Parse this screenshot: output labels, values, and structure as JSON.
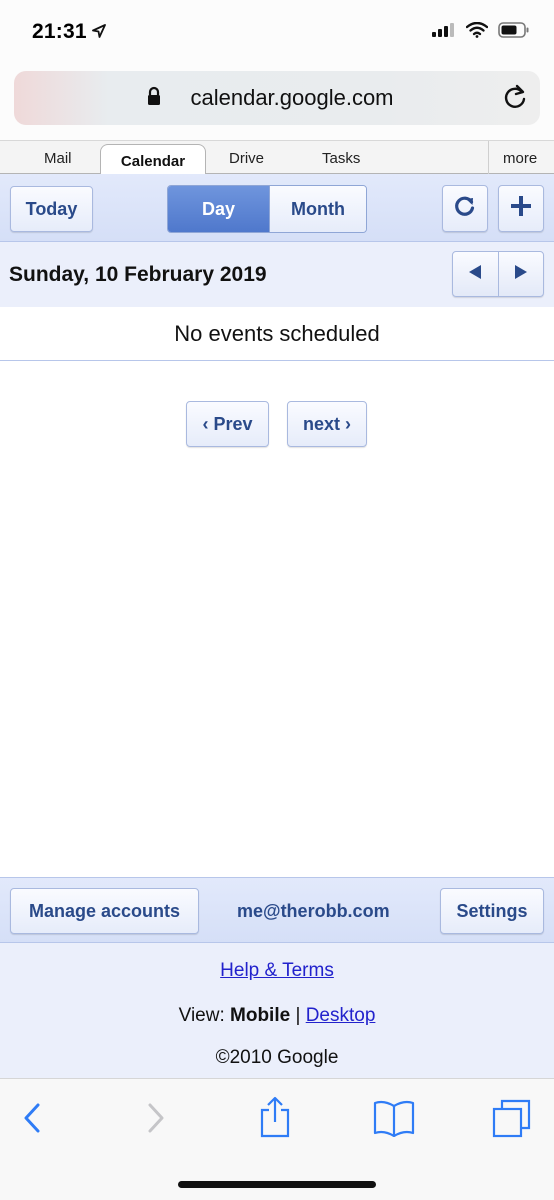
{
  "status": {
    "time": "21:31"
  },
  "browser": {
    "url": "calendar.google.com"
  },
  "tabs": {
    "items": [
      {
        "label": "Mail"
      },
      {
        "label": "Calendar"
      },
      {
        "label": "Drive"
      },
      {
        "label": "Tasks"
      }
    ],
    "active": "Calendar",
    "more_label": "more"
  },
  "toolbar": {
    "today_label": "Today",
    "view_day_label": "Day",
    "view_month_label": "Month",
    "selected_view": "Day"
  },
  "date_header": {
    "date": "Sunday, 10 February 2019"
  },
  "events": {
    "empty_message": "No events scheduled"
  },
  "pager": {
    "prev_label": "‹ Prev",
    "next_label": "next ›"
  },
  "account": {
    "manage_label": "Manage accounts",
    "email": "me@therobb.com",
    "settings_label": "Settings"
  },
  "footer": {
    "help_label": "Help & Terms",
    "view_prefix": "View:",
    "view_mobile": "Mobile",
    "view_separator": "|",
    "view_desktop": "Desktop",
    "copyright": "©2010 Google"
  },
  "colors": {
    "accent": "#4f78cc",
    "button_text": "#2a4a8a",
    "toolbar_bg": "#dbe3f9",
    "link": "#2222cc",
    "safari_blue": "#2f7cf6"
  }
}
